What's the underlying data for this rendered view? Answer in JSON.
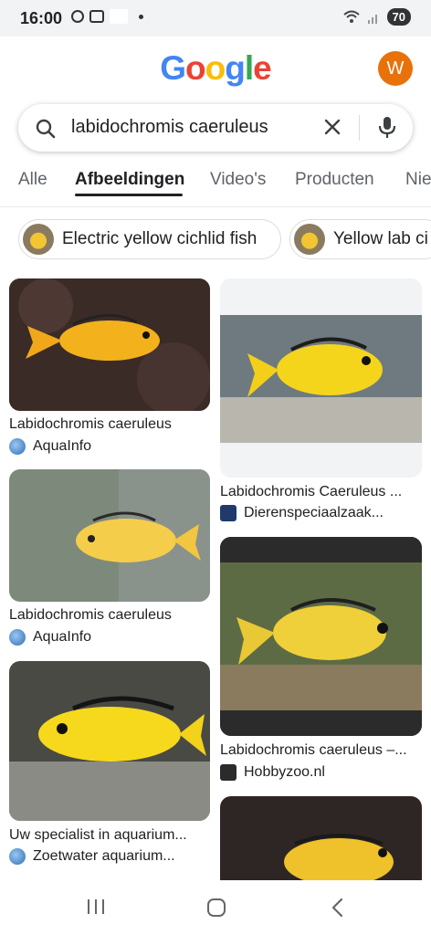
{
  "status_bar": {
    "time": "16:00",
    "battery": "70"
  },
  "header": {
    "logo": [
      "G",
      "o",
      "o",
      "g",
      "l",
      "e"
    ],
    "logo_colors": [
      "#4285f4",
      "#ea4335",
      "#fbbc05",
      "#4285f4",
      "#34a853",
      "#ea4335"
    ],
    "avatar_letter": "W",
    "avatar_color": "#e8710a"
  },
  "search": {
    "query": "labidochromis caeruleus"
  },
  "tabs": [
    "Alle",
    "Afbeeldingen",
    "Video's",
    "Producten",
    "Nie"
  ],
  "active_tab": "Afbeeldingen",
  "chips": [
    "Electric yellow cichlid fish",
    "Yellow lab ci"
  ],
  "results": [
    {
      "title": "Labidochromis caeruleus",
      "source": "AquaInfo"
    },
    {
      "title": "Labidochromis Caeruleus ...",
      "source": "Dierenspeciaalzaak..."
    },
    {
      "title": "Labidochromis caeruleus",
      "source": "AquaInfo"
    },
    {
      "title": "Labidochromis caeruleus –...",
      "source": "Hobbyzoo.nl"
    },
    {
      "title": "Uw specialist in aquarium...",
      "source": "Zoetwater aquarium..."
    }
  ]
}
